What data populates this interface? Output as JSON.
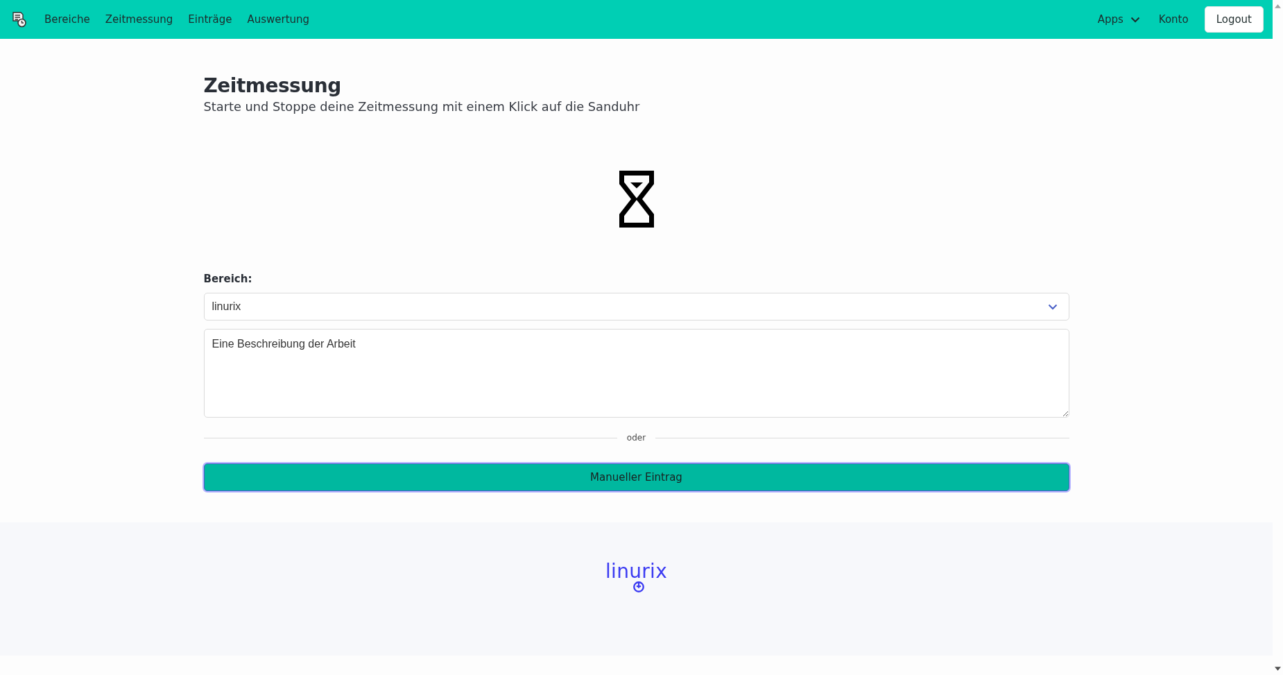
{
  "navbar": {
    "items": [
      {
        "label": "Bereiche"
      },
      {
        "label": "Zeitmessung"
      },
      {
        "label": "Einträge"
      },
      {
        "label": "Auswertung"
      }
    ],
    "apps": {
      "label": "Apps"
    },
    "account": {
      "label": "Konto"
    },
    "logout": {
      "label": "Logout"
    }
  },
  "header": {
    "title": "Zeitmessung",
    "subtitle": "Starte und Stoppe deine Zeitmessung mit einem Klick auf die Sanduhr"
  },
  "form": {
    "area": {
      "label": "Bereich:",
      "value": "linurix"
    },
    "description": {
      "value": "Eine Beschreibung der Arbeit"
    },
    "divider": "oder",
    "manual_button": {
      "label": "Manueller Eintrag",
      "focused": true
    }
  },
  "footer": {
    "logo": "linurix"
  }
}
